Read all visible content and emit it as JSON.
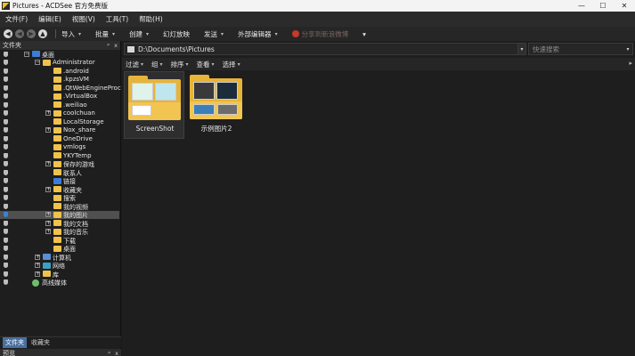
{
  "window": {
    "title": "Pictures - ACDSee 官方免费版",
    "controls": {
      "minimize": "—",
      "maximize": "☐",
      "close": "✕"
    }
  },
  "menu": {
    "items": [
      "文件(F)",
      "编辑(E)",
      "视图(V)",
      "工具(T)",
      "帮助(H)"
    ]
  },
  "toolbar": {
    "nav": [
      "◀",
      "◀",
      "▶",
      "▲"
    ],
    "items": [
      {
        "label": "导入",
        "dropdown": true
      },
      {
        "label": "批量",
        "dropdown": true
      },
      {
        "label": "创建",
        "dropdown": true
      },
      {
        "label": "幻灯放映",
        "dropdown": false
      },
      {
        "label": "发送",
        "dropdown": true
      },
      {
        "label": "外部编辑器",
        "dropdown": true
      },
      {
        "label": "分享到新浪微博",
        "dropdown": false,
        "disabled": true
      }
    ],
    "overflow": "▾"
  },
  "folders_panel": {
    "title": "文件夹",
    "controls": {
      "pin": "ᵖ",
      "close": "x"
    },
    "tree": [
      {
        "label": "桌面",
        "depth": 0,
        "icon": "blue",
        "expander": "−"
      },
      {
        "label": "Administrator",
        "depth": 1,
        "icon": "folder",
        "expander": "−"
      },
      {
        "label": ".android",
        "depth": 2,
        "icon": "folder",
        "expander": ""
      },
      {
        "label": ".kpzsVM",
        "depth": 2,
        "icon": "folder",
        "expander": ""
      },
      {
        "label": ".QtWebEngineProcess",
        "depth": 2,
        "icon": "folder",
        "expander": ""
      },
      {
        "label": ".VirtualBox",
        "depth": 2,
        "icon": "folder",
        "expander": ""
      },
      {
        "label": ".weiliao",
        "depth": 2,
        "icon": "folder",
        "expander": ""
      },
      {
        "label": "coolchuan",
        "depth": 2,
        "icon": "folder",
        "expander": "+"
      },
      {
        "label": "LocalStorage",
        "depth": 2,
        "icon": "folder",
        "expander": ""
      },
      {
        "label": "Nox_share",
        "depth": 2,
        "icon": "folder",
        "expander": "+"
      },
      {
        "label": "OneDrive",
        "depth": 2,
        "icon": "folder",
        "expander": ""
      },
      {
        "label": "vmlogs",
        "depth": 2,
        "icon": "folder",
        "expander": ""
      },
      {
        "label": "YKYTemp",
        "depth": 2,
        "icon": "folder",
        "expander": ""
      },
      {
        "label": "保存的游戏",
        "depth": 2,
        "icon": "folder",
        "expander": "+"
      },
      {
        "label": "联系人",
        "depth": 2,
        "icon": "folder",
        "expander": ""
      },
      {
        "label": "链接",
        "depth": 2,
        "icon": "blue",
        "expander": ""
      },
      {
        "label": "收藏夹",
        "depth": 2,
        "icon": "folder",
        "expander": "+"
      },
      {
        "label": "搜索",
        "depth": 2,
        "icon": "folder",
        "expander": ""
      },
      {
        "label": "我的视频",
        "depth": 2,
        "icon": "folder",
        "expander": ""
      },
      {
        "label": "我的图片",
        "depth": 2,
        "icon": "folder",
        "expander": "+",
        "selected": true
      },
      {
        "label": "我的文档",
        "depth": 2,
        "icon": "folder",
        "expander": "+"
      },
      {
        "label": "我的音乐",
        "depth": 2,
        "icon": "folder",
        "expander": "+"
      },
      {
        "label": "下载",
        "depth": 2,
        "icon": "folder",
        "expander": ""
      },
      {
        "label": "桌面",
        "depth": 2,
        "icon": "folder",
        "expander": ""
      },
      {
        "label": "计算机",
        "depth": 1,
        "icon": "pc",
        "expander": "+"
      },
      {
        "label": "网络",
        "depth": 1,
        "icon": "net",
        "expander": "+"
      },
      {
        "label": "库",
        "depth": 1,
        "icon": "folder",
        "expander": "+"
      },
      {
        "label": "高线媒体",
        "depth": 0,
        "icon": "media",
        "expander": ""
      }
    ],
    "tabs": [
      "文件夹",
      "收藏夹"
    ],
    "active_tab": "文件夹"
  },
  "preview_panel": {
    "title": "预览",
    "controls": {
      "pin": "ᵖ",
      "close": "x"
    }
  },
  "path_bar": {
    "path": "D:\\Documents\\Pictures",
    "search_placeholder": "快速搜索"
  },
  "filter_bar": {
    "items": [
      "过滤",
      "组",
      "排序",
      "查看",
      "选择"
    ],
    "overflow": "▸"
  },
  "thumbnails": [
    {
      "label": "ScreenShot",
      "selected": true
    },
    {
      "label": "示例图片2",
      "selected": false
    }
  ],
  "icons": {
    "pin": "pin-icon",
    "folder": "folder-icon",
    "computer": "computer-icon",
    "network": "network-icon",
    "media": "media-icon",
    "share": "weibo-icon"
  },
  "colors": {
    "background": "#1b1b1b",
    "panel": "#1e1e1e",
    "bar": "#262626",
    "folder": "#e7b43a",
    "selection": "#505050",
    "active_tab": "#4a6fa0"
  }
}
